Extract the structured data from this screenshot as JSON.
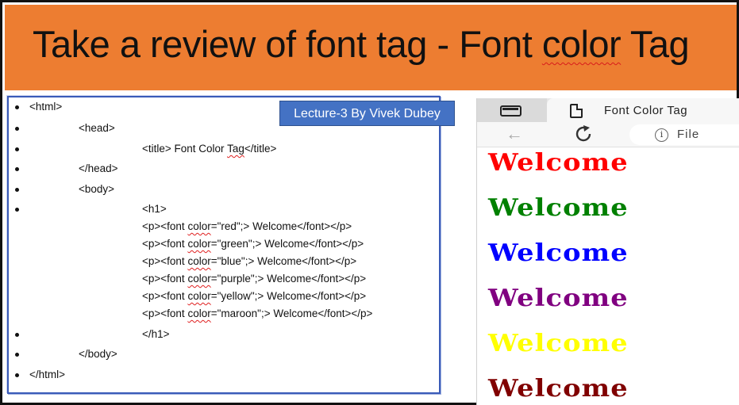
{
  "slide": {
    "title_parts": [
      "Take a review of font tag - Font ",
      "color",
      " Tag"
    ],
    "badge": "Lecture-3 By Vivek Dubey"
  },
  "code": {
    "lines": [
      [
        "<html>"
      ],
      [
        "<head>"
      ],
      [
        "<title> Font Color ",
        "Tag",
        "</title>"
      ],
      [
        "</head>"
      ],
      [
        "<body>"
      ],
      [
        "<h1>"
      ],
      [
        "<p><font ",
        "color",
        "=\"red\";> Welcome</font></p>"
      ],
      [
        "<p><font ",
        "color",
        "=\"green\";> Welcome</font></p>"
      ],
      [
        "<p><font ",
        "color",
        "=\"blue\";> Welcome</font></p>"
      ],
      [
        "<p><font ",
        "color",
        "=\"purple\";> Welcome</font></p>"
      ],
      [
        "<p><font ",
        "color",
        "=\"yellow\";> Welcome</font></p>"
      ],
      [
        "<p><font ",
        "color",
        "=\"maroon\";> Welcome</font></p>"
      ],
      [
        "</h1>"
      ],
      [
        "</body>"
      ],
      [
        "</html>"
      ]
    ]
  },
  "browser": {
    "tab_title": "Font Color Tag",
    "address_text": "File",
    "back_icon": "back-arrow-icon",
    "reload_icon": "reload-icon",
    "info_icon": "info-icon",
    "info_glyph": "i",
    "back_glyph": "←"
  },
  "preview": {
    "items": [
      {
        "text": "Welcome",
        "color": "#ff0000"
      },
      {
        "text": "Welcome",
        "color": "#008000"
      },
      {
        "text": "Welcome",
        "color": "#0000ff"
      },
      {
        "text": "Welcome",
        "color": "#800080"
      },
      {
        "text": "Welcome",
        "color": "#ffff00"
      },
      {
        "text": "Welcome",
        "color": "#800000"
      }
    ]
  }
}
